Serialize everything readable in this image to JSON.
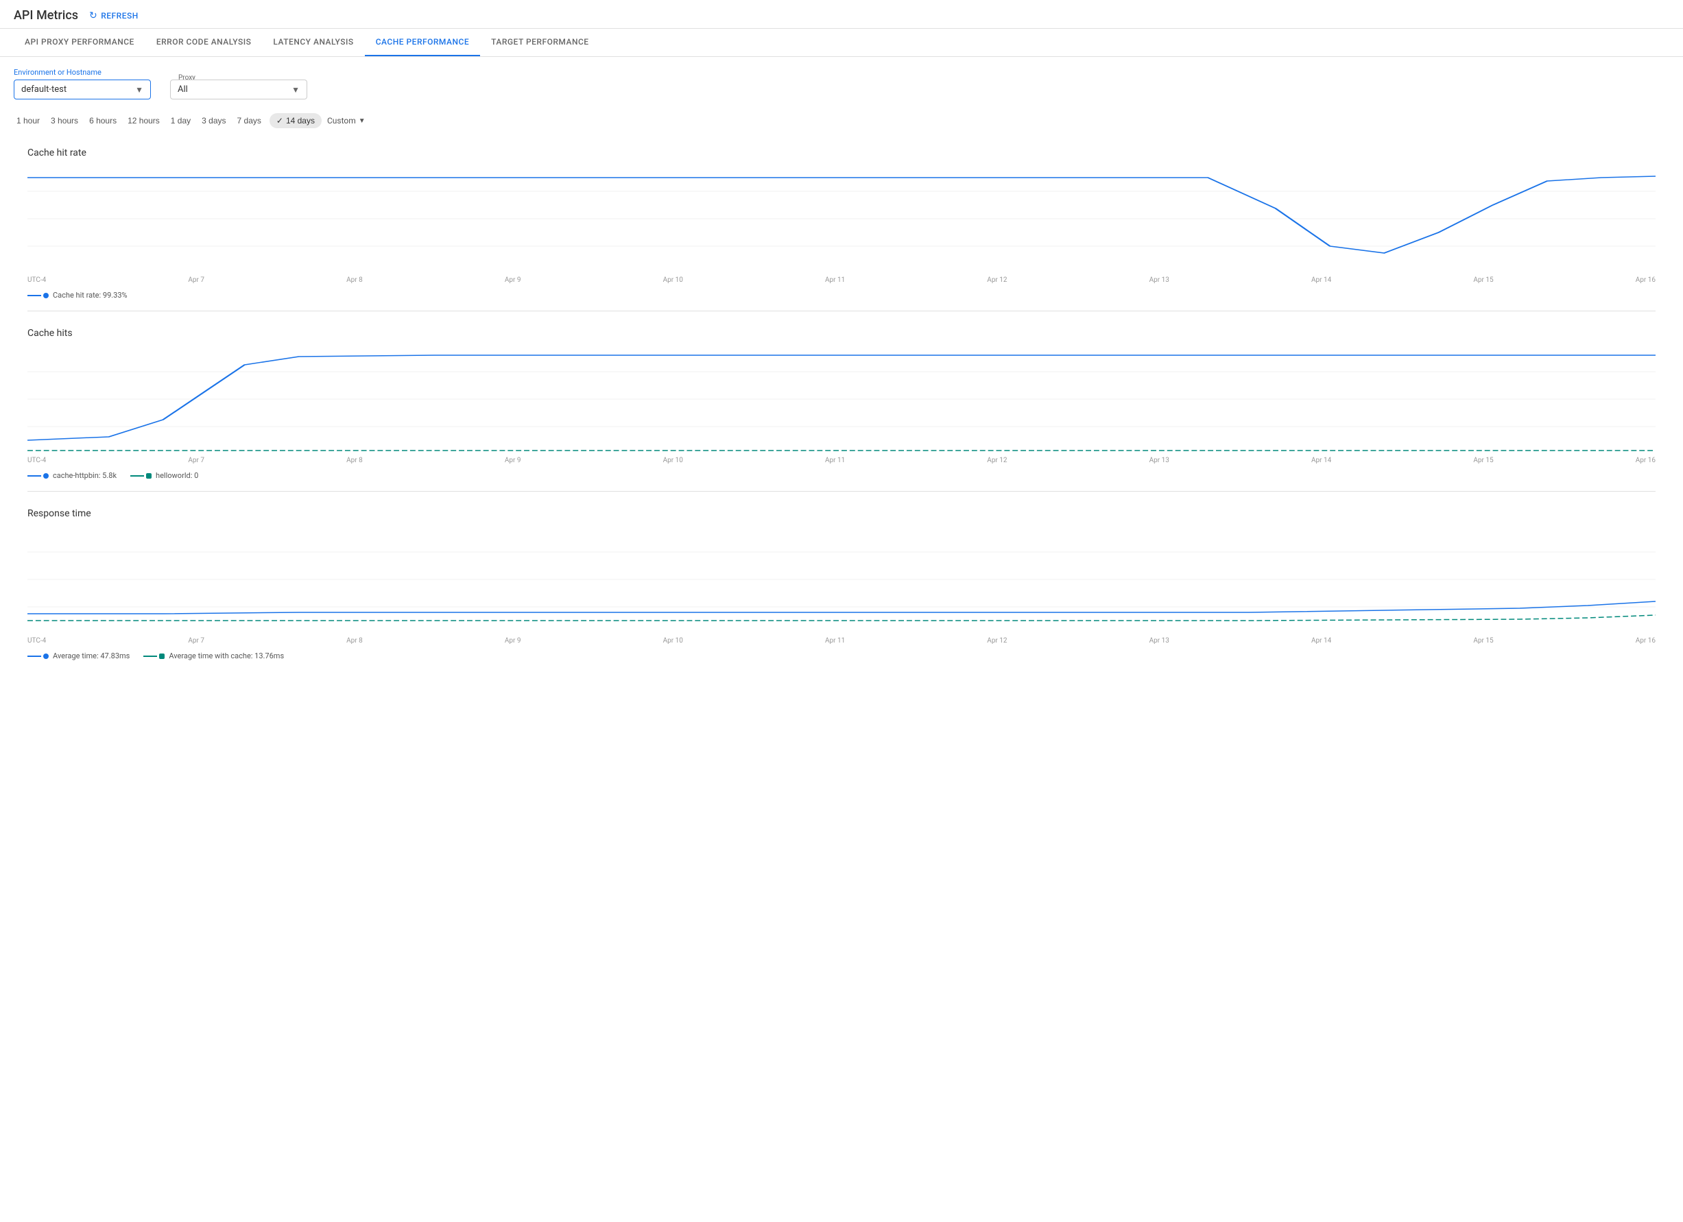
{
  "header": {
    "title": "API Metrics",
    "refresh_label": "REFRESH"
  },
  "tabs": [
    {
      "id": "api-proxy",
      "label": "API PROXY PERFORMANCE",
      "active": false
    },
    {
      "id": "error-code",
      "label": "ERROR CODE ANALYSIS",
      "active": false
    },
    {
      "id": "latency",
      "label": "LATENCY ANALYSIS",
      "active": false
    },
    {
      "id": "cache",
      "label": "CACHE PERFORMANCE",
      "active": true
    },
    {
      "id": "target",
      "label": "TARGET PERFORMANCE",
      "active": false
    }
  ],
  "filters": {
    "environment_label": "Environment or Hostname",
    "environment_value": "default-test",
    "proxy_label": "Proxy",
    "proxy_value": "All"
  },
  "time_filters": [
    {
      "id": "1h",
      "label": "1 hour",
      "active": false
    },
    {
      "id": "3h",
      "label": "3 hours",
      "active": false
    },
    {
      "id": "6h",
      "label": "6 hours",
      "active": false
    },
    {
      "id": "12h",
      "label": "12 hours",
      "active": false
    },
    {
      "id": "1d",
      "label": "1 day",
      "active": false
    },
    {
      "id": "3d",
      "label": "3 days",
      "active": false
    },
    {
      "id": "7d",
      "label": "7 days",
      "active": false
    },
    {
      "id": "14d",
      "label": "14 days",
      "active": true
    },
    {
      "id": "custom",
      "label": "Custom",
      "active": false
    }
  ],
  "charts": {
    "cache_hit_rate": {
      "title": "Cache hit rate",
      "x_labels": [
        "UTC-4",
        "Apr 7",
        "Apr 8",
        "Apr 9",
        "Apr 10",
        "Apr 11",
        "Apr 12",
        "Apr 13",
        "Apr 14",
        "Apr 15",
        "Apr 16"
      ],
      "legend": [
        {
          "label": "Cache hit rate: 99.33%",
          "color": "#1a73e8"
        }
      ]
    },
    "cache_hits": {
      "title": "Cache hits",
      "x_labels": [
        "UTC-4",
        "Apr 7",
        "Apr 8",
        "Apr 9",
        "Apr 10",
        "Apr 11",
        "Apr 12",
        "Apr 13",
        "Apr 14",
        "Apr 15",
        "Apr 16"
      ],
      "legend": [
        {
          "label": "cache-httpbin: 5.8k",
          "color": "#1a73e8"
        },
        {
          "label": "helloworld: 0",
          "color": "#00897b"
        }
      ]
    },
    "response_time": {
      "title": "Response time",
      "x_labels": [
        "UTC-4",
        "Apr 7",
        "Apr 8",
        "Apr 9",
        "Apr 10",
        "Apr 11",
        "Apr 12",
        "Apr 13",
        "Apr 14",
        "Apr 15",
        "Apr 16"
      ],
      "legend": [
        {
          "label": "Average time: 47.83ms",
          "color": "#1a73e8"
        },
        {
          "label": "Average time with cache: 13.76ms",
          "color": "#00897b"
        }
      ]
    }
  }
}
